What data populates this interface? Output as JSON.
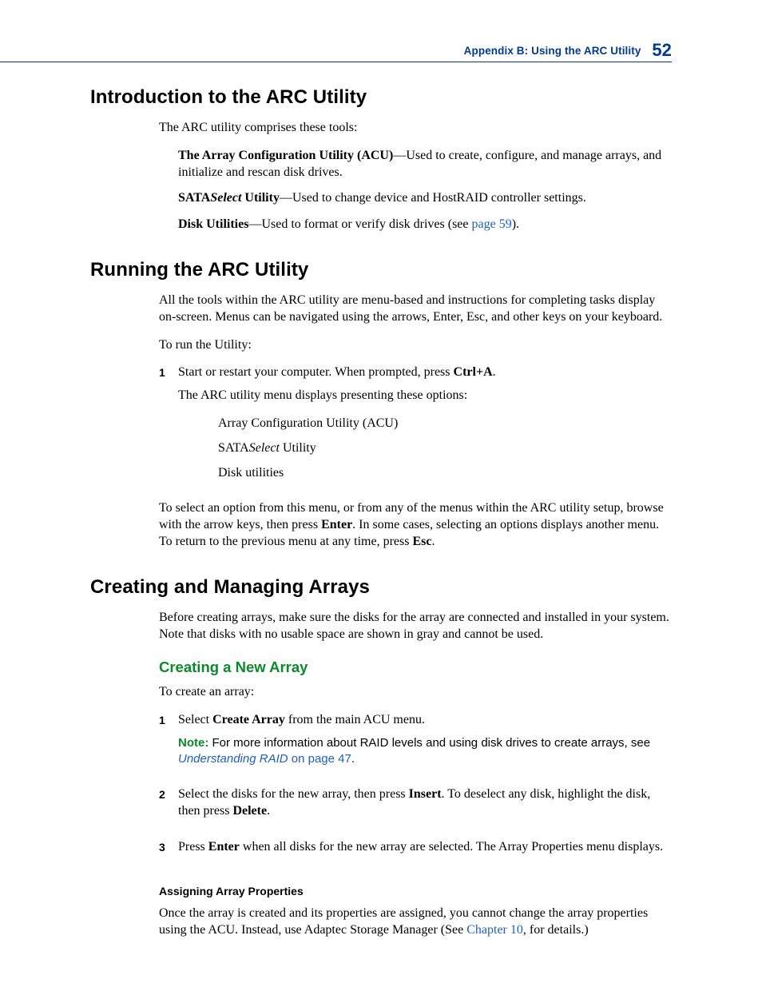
{
  "header": {
    "running": "Appendix B: Using the ARC Utility",
    "page_number": "52"
  },
  "sections": {
    "intro": {
      "title": "Introduction to the ARC Utility",
      "lead": "The ARC utility comprises these tools:",
      "items": {
        "acu_label": "The Array Configuration Utility (ACU)",
        "acu_desc": "—Used to create, configure, and manage arrays, and initialize and rescan disk drives.",
        "sata_label_a": "SATA",
        "sata_label_b": "Select",
        "sata_label_c": " Utility",
        "sata_desc": "—Used to change device and HostRAID controller settings.",
        "disk_label": "Disk Utilities",
        "disk_desc_a": "—Used to format or verify disk drives (see ",
        "disk_link": "page 59",
        "disk_desc_b": ")."
      }
    },
    "running": {
      "title": "Running the ARC Utility",
      "lead1": "All the tools within the ARC utility are menu-based and instructions for completing tasks display on-screen. Menus can be navigated using the arrows, Enter, Esc, and other keys on your keyboard.",
      "lead2": "To run the Utility:",
      "step1_num": "1",
      "step1_a": "Start or restart your computer. When prompted, press ",
      "step1_key": "Ctrl+A",
      "step1_b": ".",
      "step1_sub": "The ARC utility menu displays presenting these options:",
      "opts": {
        "a": "Array Configuration Utility (ACU)",
        "b_a": "SATA",
        "b_b": "Select",
        "b_c": " Utility",
        "c": "Disk utilities"
      },
      "tail_a": "To select an option from this menu, or from any of the menus within the ARC utility setup, browse with the arrow keys, then press ",
      "tail_enter": "Enter",
      "tail_b": ". In some cases, selecting an options displays another menu. To return to the previous menu at any time, press ",
      "tail_esc": "Esc",
      "tail_c": "."
    },
    "arrays": {
      "title": "Creating and Managing Arrays",
      "lead": "Before creating arrays, make sure the disks for the array are connected and installed in your system. Note that disks with no usable space are shown in gray and cannot be used.",
      "create": {
        "title": "Creating a New Array",
        "lead": "To create an array:",
        "s1_num": "1",
        "s1_a": "Select ",
        "s1_bold": "Create Array",
        "s1_b": " from the main ACU menu.",
        "note_label": "Note:",
        "note_a": " For more information about RAID levels and using disk drives to create arrays, see ",
        "note_link_ital": "Understanding RAID",
        "note_link_rest": " on page 47",
        "note_b": ".",
        "s2_num": "2",
        "s2_a": "Select the disks for the new array, then press ",
        "s2_bold1": "Insert",
        "s2_b": ". To deselect any disk, highlight the disk, then press ",
        "s2_bold2": "Delete",
        "s2_c": ".",
        "s3_num": "3",
        "s3_a": "Press ",
        "s3_bold": "Enter",
        "s3_b": " when all disks for the new array are selected. The Array Properties menu displays."
      },
      "assign": {
        "title": "Assigning Array Properties",
        "p_a": "Once the array is created and its properties are assigned, you cannot change the array properties using the ACU. Instead, use Adaptec Storage Manager (See ",
        "p_link": "Chapter 10",
        "p_b": ", for details.)"
      }
    }
  }
}
